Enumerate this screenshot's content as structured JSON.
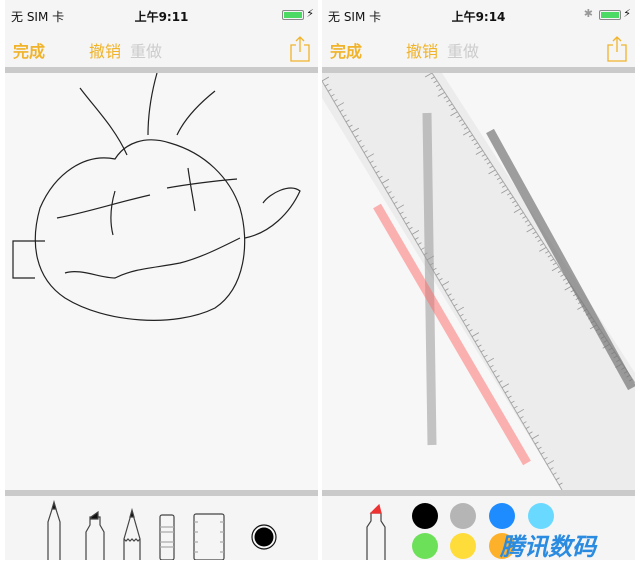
{
  "left": {
    "status": {
      "carrier": "无 SIM 卡",
      "time": "上午9:11"
    },
    "nav": {
      "done": "完成",
      "undo": "撤销",
      "redo": "重做"
    },
    "tools": [
      "pen",
      "marker",
      "pencil",
      "eraser",
      "ruler"
    ],
    "selected_color": "#000000"
  },
  "right": {
    "status": {
      "carrier": "无 SIM 卡",
      "time": "上午9:14"
    },
    "nav": {
      "done": "完成",
      "undo": "撤销",
      "redo": "重做"
    },
    "tool": "marker",
    "palette": [
      "#000000",
      "#b5b5b5",
      "#1e8bff",
      "#6ad9ff",
      "#6de05a",
      "#fedc3a",
      "#fdb02a"
    ]
  },
  "colors": {
    "accent": "#f0b32a"
  },
  "watermark": "腾讯数码"
}
